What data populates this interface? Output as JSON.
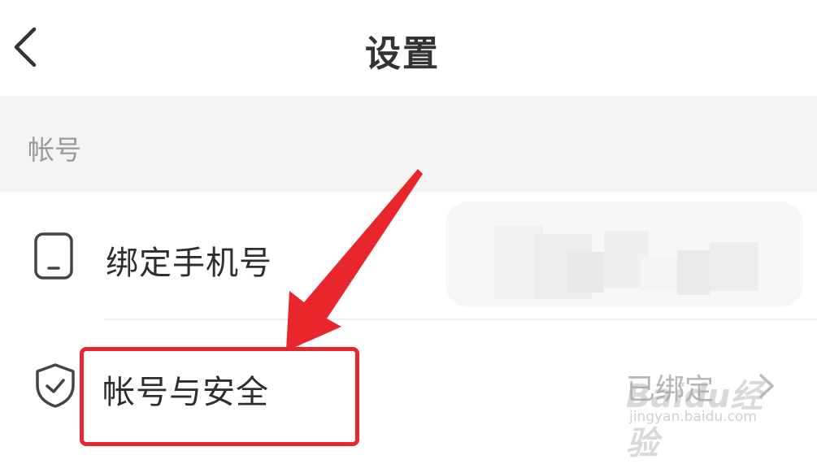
{
  "header": {
    "title": "设置",
    "back_icon": "chevron-left-icon"
  },
  "section": {
    "label": "帐号"
  },
  "rows": [
    {
      "label": "绑定手机号",
      "icon": "phone-icon",
      "value_state": "blurred"
    },
    {
      "label": "帐号与安全",
      "icon": "shield-check-icon",
      "value": "已绑定",
      "trailing_icon": "chevron-right-icon"
    }
  ],
  "annotation": {
    "highlight_color": "#e8262b",
    "arrow_color": "#e8262b"
  },
  "watermark": {
    "logo": "Baidu经验",
    "url": "jingyan.baidu.com"
  }
}
